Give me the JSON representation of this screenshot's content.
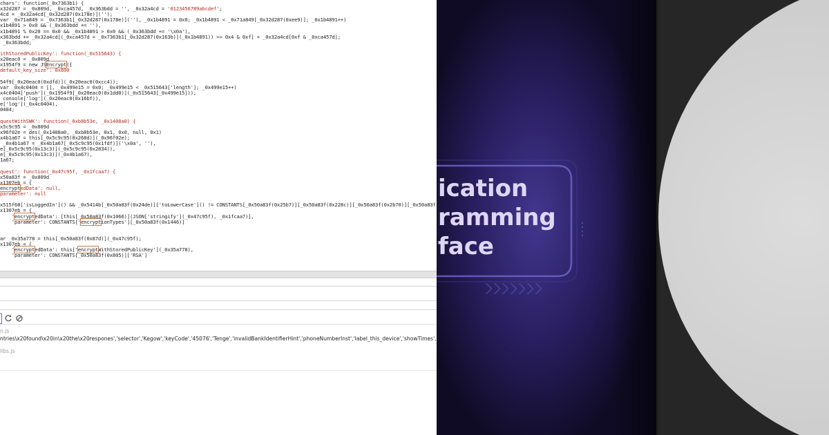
{
  "code_lines": [
    {
      "segs": [
        {
          "t": "chars': function(_0x7363b1) {"
        }
      ]
    },
    {
      "segs": [
        {
          "t": "x32d287 = _0x809d, _0xca457d, _0x363bdd = '', _0x32a4cd = "
        },
        {
          "t": "'0123456789abcdef'",
          "c": "str"
        },
        {
          "t": ";"
        }
      ]
    },
    {
      "segs": [
        {
          "t": "4cd = _0x32a4cd[_0x32d287(0x178e)]('');"
        }
      ]
    },
    {
      "segs": [
        {
          "t": "var _0x71a849 = _0x7363b1[_0x32d287(0x178e)](''), _0x1b4891 = 0x0; _0x1b4891 < _0x71a849[_0x32d287(0xee9)]; _0x1b4891++)"
        }
      ]
    },
    {
      "segs": [
        {
          "t": "x1b4891 > 0x0 && (_0x363bdd += ''),"
        }
      ]
    },
    {
      "segs": [
        {
          "t": "x1b4891 % 0x20 == 0x0 && _0x1b4891 > 0x0 && (_0x363bdd += '\\x0a'),"
        }
      ]
    },
    {
      "segs": [
        {
          "t": "x363bdd += _0x32a4cd[(_0xca457d = _0x7363b1[_0x32d287(0x163b)](_0x1b4891)) >> 0x4 & 0xf] + _0x32a4cd[0xf & _0xca457d];"
        }
      ]
    },
    {
      "segs": [
        {
          "t": " _0x363bdd;"
        }
      ]
    },
    {
      "segs": [
        {
          "t": ""
        }
      ]
    },
    {
      "segs": [
        {
          "t": "ithStoredPublicKey': function(_0x515643) {",
          "c": "str"
        }
      ]
    },
    {
      "segs": [
        {
          "t": "x20eac0 = _0x809d"
        }
      ]
    },
    {
      "segs": [
        {
          "t": "x1954f9 = new JS"
        },
        {
          "t": "Encrypt",
          "c": "hl"
        },
        {
          "t": "({"
        }
      ]
    },
    {
      "segs": [
        {
          "t": "default_key_size': 0x800",
          "c": "str"
        }
      ]
    },
    {
      "segs": [
        {
          "t": ""
        }
      ]
    },
    {
      "segs": [
        {
          "t": "54f9[_0x20eac0(0xdfd)](_0x20eac0(0xcc4));"
        }
      ]
    },
    {
      "segs": [
        {
          "t": "var _0x4c0404 = [], _0x499e15 = 0x0; _0x499e15 < _0x515643['length']; _0x499e15++)"
        }
      ]
    },
    {
      "segs": [
        {
          "t": "x4c0404['push'](_0x1954f9[_0x20eac0(0x1dd0)](_0x515643[_0x499e15]));"
        }
      ]
    },
    {
      "segs": [
        {
          "t": " console['log'](_0x20eac0(0x16bf)),"
        }
      ]
    },
    {
      "segs": [
        {
          "t": "e['log'](_0x4c0404),"
        }
      ]
    },
    {
      "segs": [
        {
          "t": "0404;"
        }
      ]
    },
    {
      "segs": [
        {
          "t": ""
        }
      ]
    },
    {
      "segs": [
        {
          "t": "questWithSWK': function(_0xb8b53e, _0x1408a0) {",
          "c": "str"
        }
      ]
    },
    {
      "segs": [
        {
          "t": "x5c9c95 = _0x809d"
        }
      ]
    },
    {
      "segs": [
        {
          "t": "x96f02e = des(_0x1408a0, _0xb8b53e, 0x1, 0x0, null, 0x1)"
        }
      ]
    },
    {
      "segs": [
        {
          "t": "x4b1a67 = this[_0x5c9c95(0x268d)](_0x96f02e);"
        }
      ]
    },
    {
      "segs": [
        {
          "t": " _0x4b1a67 = _0x4b1a67[_0x5c9c95(0x1fdf)]('\\x0a', ''),"
        }
      ]
    },
    {
      "segs": [
        {
          "t": "e[_0x5c9c95(0x13c3)](_0x5c9c95(0x2834)),"
        }
      ]
    },
    {
      "segs": [
        {
          "t": "e[_0x5c9c95(0x13c3)](_0x4b1a67),"
        }
      ]
    },
    {
      "segs": [
        {
          "t": "1a67;"
        }
      ]
    },
    {
      "segs": [
        {
          "t": ""
        }
      ]
    },
    {
      "segs": [
        {
          "t": "quest': function(_0x47c95f, _0x1fcaa7) {",
          "c": "str"
        }
      ]
    },
    {
      "segs": [
        {
          "t": "x50a83f = _0x809d"
        }
      ]
    },
    {
      "segs": [
        {
          "t": "x1307eb = {"
        }
      ]
    },
    {
      "segs": [
        {
          "t": "encrypt",
          "c": "hl"
        },
        {
          "t": "edData': null,",
          "c": "str"
        }
      ]
    },
    {
      "segs": [
        {
          "t": "parameter': null",
          "c": "str"
        }
      ]
    },
    {
      "segs": [
        {
          "t": ""
        }
      ]
    },
    {
      "segs": [
        {
          "t": "x515f68['isLoggedIn']() && _0x5414b[_0x50a83f(0x24de)]['toLowerCase']() != CONSTANTS[_0x50a83f(0x25b7)][_0x50a83f(0x228c)][_0x50a83f(0x2b70)][_0x50a83f(0x2"
        }
      ]
    },
    {
      "segs": [
        {
          "t": "x1307eb = {"
        }
      ]
    },
    {
      "segs": [
        {
          "t": "    '"
        },
        {
          "t": "encrypt",
          "c": "hl"
        },
        {
          "t": "edData': [this[_0x50a83f(0x1066)](JSON['stringify'](_0x47c95f), _0x1fcaa7)],"
        }
      ]
    },
    {
      "segs": [
        {
          "t": "    'parameter': CONSTANTS['"
        },
        {
          "t": "encrypt",
          "c": "hl"
        },
        {
          "t": "ionTypes'][_0x50a83f(0x1446)]"
        }
      ]
    },
    {
      "segs": [
        {
          "t": ""
        }
      ]
    },
    {
      "segs": [
        {
          "t": ""
        }
      ]
    },
    {
      "segs": [
        {
          "t": "ar _0x35a778 = this[_0x50a83f(0x87d)](_0x47c95f);"
        }
      ]
    },
    {
      "segs": [
        {
          "t": "x1307eb = {"
        }
      ]
    },
    {
      "segs": [
        {
          "t": "    '"
        },
        {
          "t": "encrypt",
          "c": "hl"
        },
        {
          "t": "edData': this['"
        },
        {
          "t": "encrypt",
          "c": "hl"
        },
        {
          "t": "WithStoredPublicKey'](_0x35a778),"
        }
      ]
    },
    {
      "segs": [
        {
          "t": "    'parameter': CONSTANTS[_0x50a83f(0x805)]['RSA']"
        }
      ]
    }
  ],
  "console": {
    "file1": "n.js",
    "output": "ntries\\x20found\\x20in\\x20the\\x20respones','selector','Kegow','keyCode','45076','Tenge','invalidBankIdentifierHint','phoneNumberInst','label_this_device','showTimes','noBanksErrMsg','receiver_ide",
    "file2": "libs.js"
  },
  "video": {
    "lines": [
      "ication",
      "ramming",
      "face"
    ]
  },
  "colors": {
    "video_bg": "#1a1238",
    "video_text": "#ddd7f4",
    "accent_outline": "#6f63c8",
    "right_panel": "#262626",
    "record_disc": "#d2d2d2"
  }
}
